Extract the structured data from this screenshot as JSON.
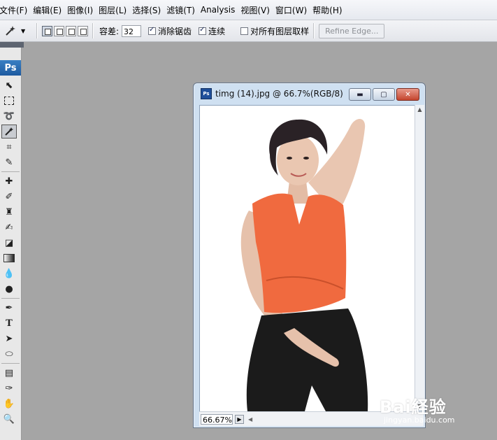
{
  "menu": [
    "文件(F)",
    "编辑(E)",
    "图像(I)",
    "图层(L)",
    "选择(S)",
    "滤镜(T)",
    "Analysis",
    "视图(V)",
    "窗口(W)",
    "帮助(H)"
  ],
  "options": {
    "tolerance_label": "容差:",
    "tolerance_value": "32",
    "antialias_label": "消除锯齿",
    "contiguous_label": "连续",
    "sample_all_label": "对所有图层取样",
    "refine_edge_label": "Refine Edge..."
  },
  "toolbox": {
    "logo": "Ps"
  },
  "document": {
    "title": "timg (14).jpg @ 66.7%(RGB/8)",
    "icon_text": "Ps",
    "zoom": "66.67%"
  },
  "watermark": {
    "main": "Bai経验",
    "sub": "jingyan.baidu.com"
  },
  "colors": {
    "accent": "#1d5aa0",
    "shirt": "#f06a3f",
    "pants": "#1b1b1b"
  }
}
